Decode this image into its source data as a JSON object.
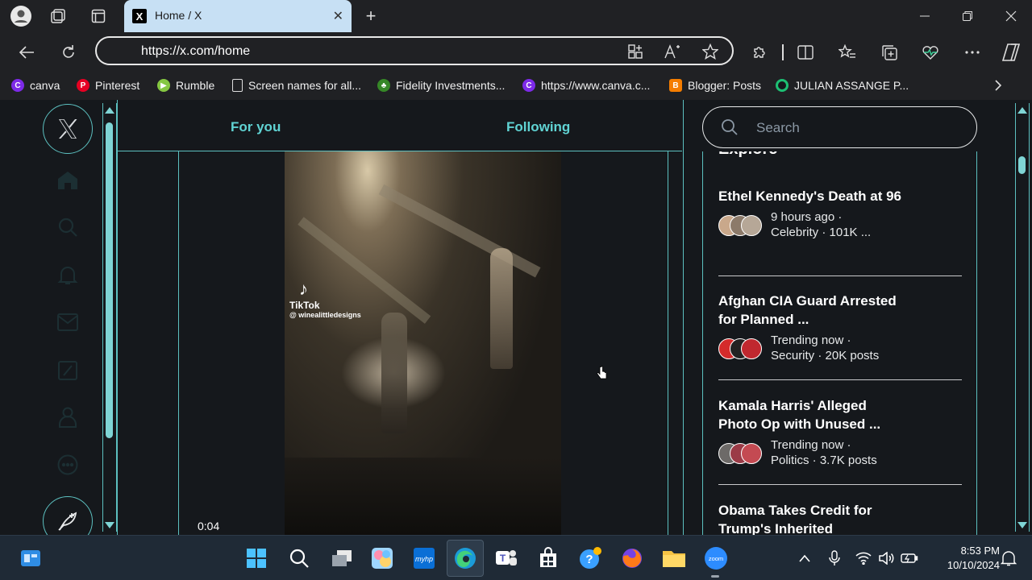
{
  "browser": {
    "tab_title": "Home / X",
    "tab_favicon_letter": "X",
    "new_tab_symbol": "+",
    "url": "https://x.com/home"
  },
  "bookmarks": [
    {
      "label": "canva",
      "icon": "canva-icon",
      "color": "#7d2ae8"
    },
    {
      "label": "Pinterest",
      "icon": "pinterest-icon",
      "color": "#e60023"
    },
    {
      "label": "Rumble",
      "icon": "rumble-icon",
      "color": "#85c742"
    },
    {
      "label": "Screen names for all...",
      "icon": "page-icon",
      "color": "#dddddd"
    },
    {
      "label": "Fidelity Investments...",
      "icon": "fidelity-icon",
      "color": "#368727"
    },
    {
      "label": "https://www.canva.c...",
      "icon": "canva-icon",
      "color": "#7d2ae8"
    },
    {
      "label": "Blogger: Posts",
      "icon": "blogger-icon",
      "color": "#f57d00"
    },
    {
      "label": "JULIAN ASSANGE P...",
      "icon": "circle-icon",
      "color": "#1dbf73"
    }
  ],
  "feed_tabs": {
    "for_you": "For you",
    "following": "Following"
  },
  "video": {
    "watermark_brand": "TikTok",
    "watermark_handle": "@ winealittledesigns",
    "timecode": "0:04"
  },
  "search": {
    "placeholder": "Search"
  },
  "explore": {
    "title": "Explore",
    "trends": [
      {
        "title": "Ethel Kennedy's Death at 96",
        "meta1": "9 hours ago ·",
        "meta2": "Celebrity · 101K ..."
      },
      {
        "title": "Afghan CIA Guard Arrested for Planned ...",
        "meta1": "Trending now ·",
        "meta2": "Security · 20K posts"
      },
      {
        "title": "Kamala Harris' Alleged Photo Op with Unused ...",
        "meta1": "Trending now ·",
        "meta2": "Politics · 3.7K posts"
      },
      {
        "title": "Obama Takes Credit for Trump's Inherited",
        "meta1": "",
        "meta2": ""
      }
    ]
  },
  "taskbar": {
    "time": "8:53 PM",
    "date": "10/10/2024",
    "zoom_label": "zoom",
    "hp_label": "myhp"
  },
  "colors": {
    "accent": "#5cc0c0",
    "tab_bg": "#c7e0f4",
    "taskbar_bg": "#1f2a36"
  }
}
